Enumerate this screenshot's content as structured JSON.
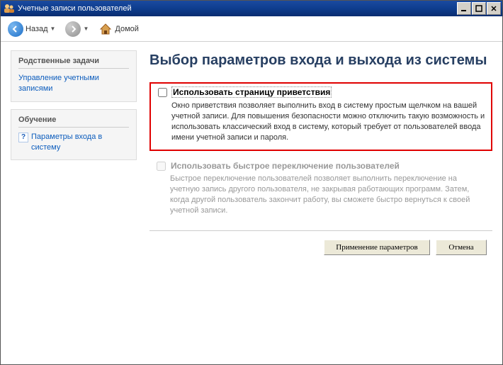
{
  "titlebar": {
    "title": "Учетные записи пользователей"
  },
  "nav": {
    "back_label": "Назад",
    "home_label": "Домой"
  },
  "sidebar": {
    "related": {
      "header": "Родственные задачи",
      "link": "Управление учетными записями"
    },
    "learn": {
      "header": "Обучение",
      "link": "Параметры входа в систему"
    }
  },
  "content": {
    "heading": "Выбор параметров входа и выхода из системы",
    "option1": {
      "label": "Использовать страницу приветствия",
      "description": "Окно приветствия позволяет выполнить вход в систему простым щелчком на вашей учетной записи. Для повышения безопасности можно отключить такую возможность и использовать классический вход в систему, который требует от пользователей ввода имени учетной записи и пароля."
    },
    "option2": {
      "label": "Использовать быстрое переключение пользователей",
      "description": "Быстрое переключение пользователей позволяет выполнить переключение на учетную запись другого пользователя, не закрывая работающих программ. Затем, когда другой пользователь закончит работу, вы сможете быстро вернуться к своей учетной записи."
    },
    "buttons": {
      "apply": "Применение параметров",
      "cancel": "Отмена"
    }
  }
}
